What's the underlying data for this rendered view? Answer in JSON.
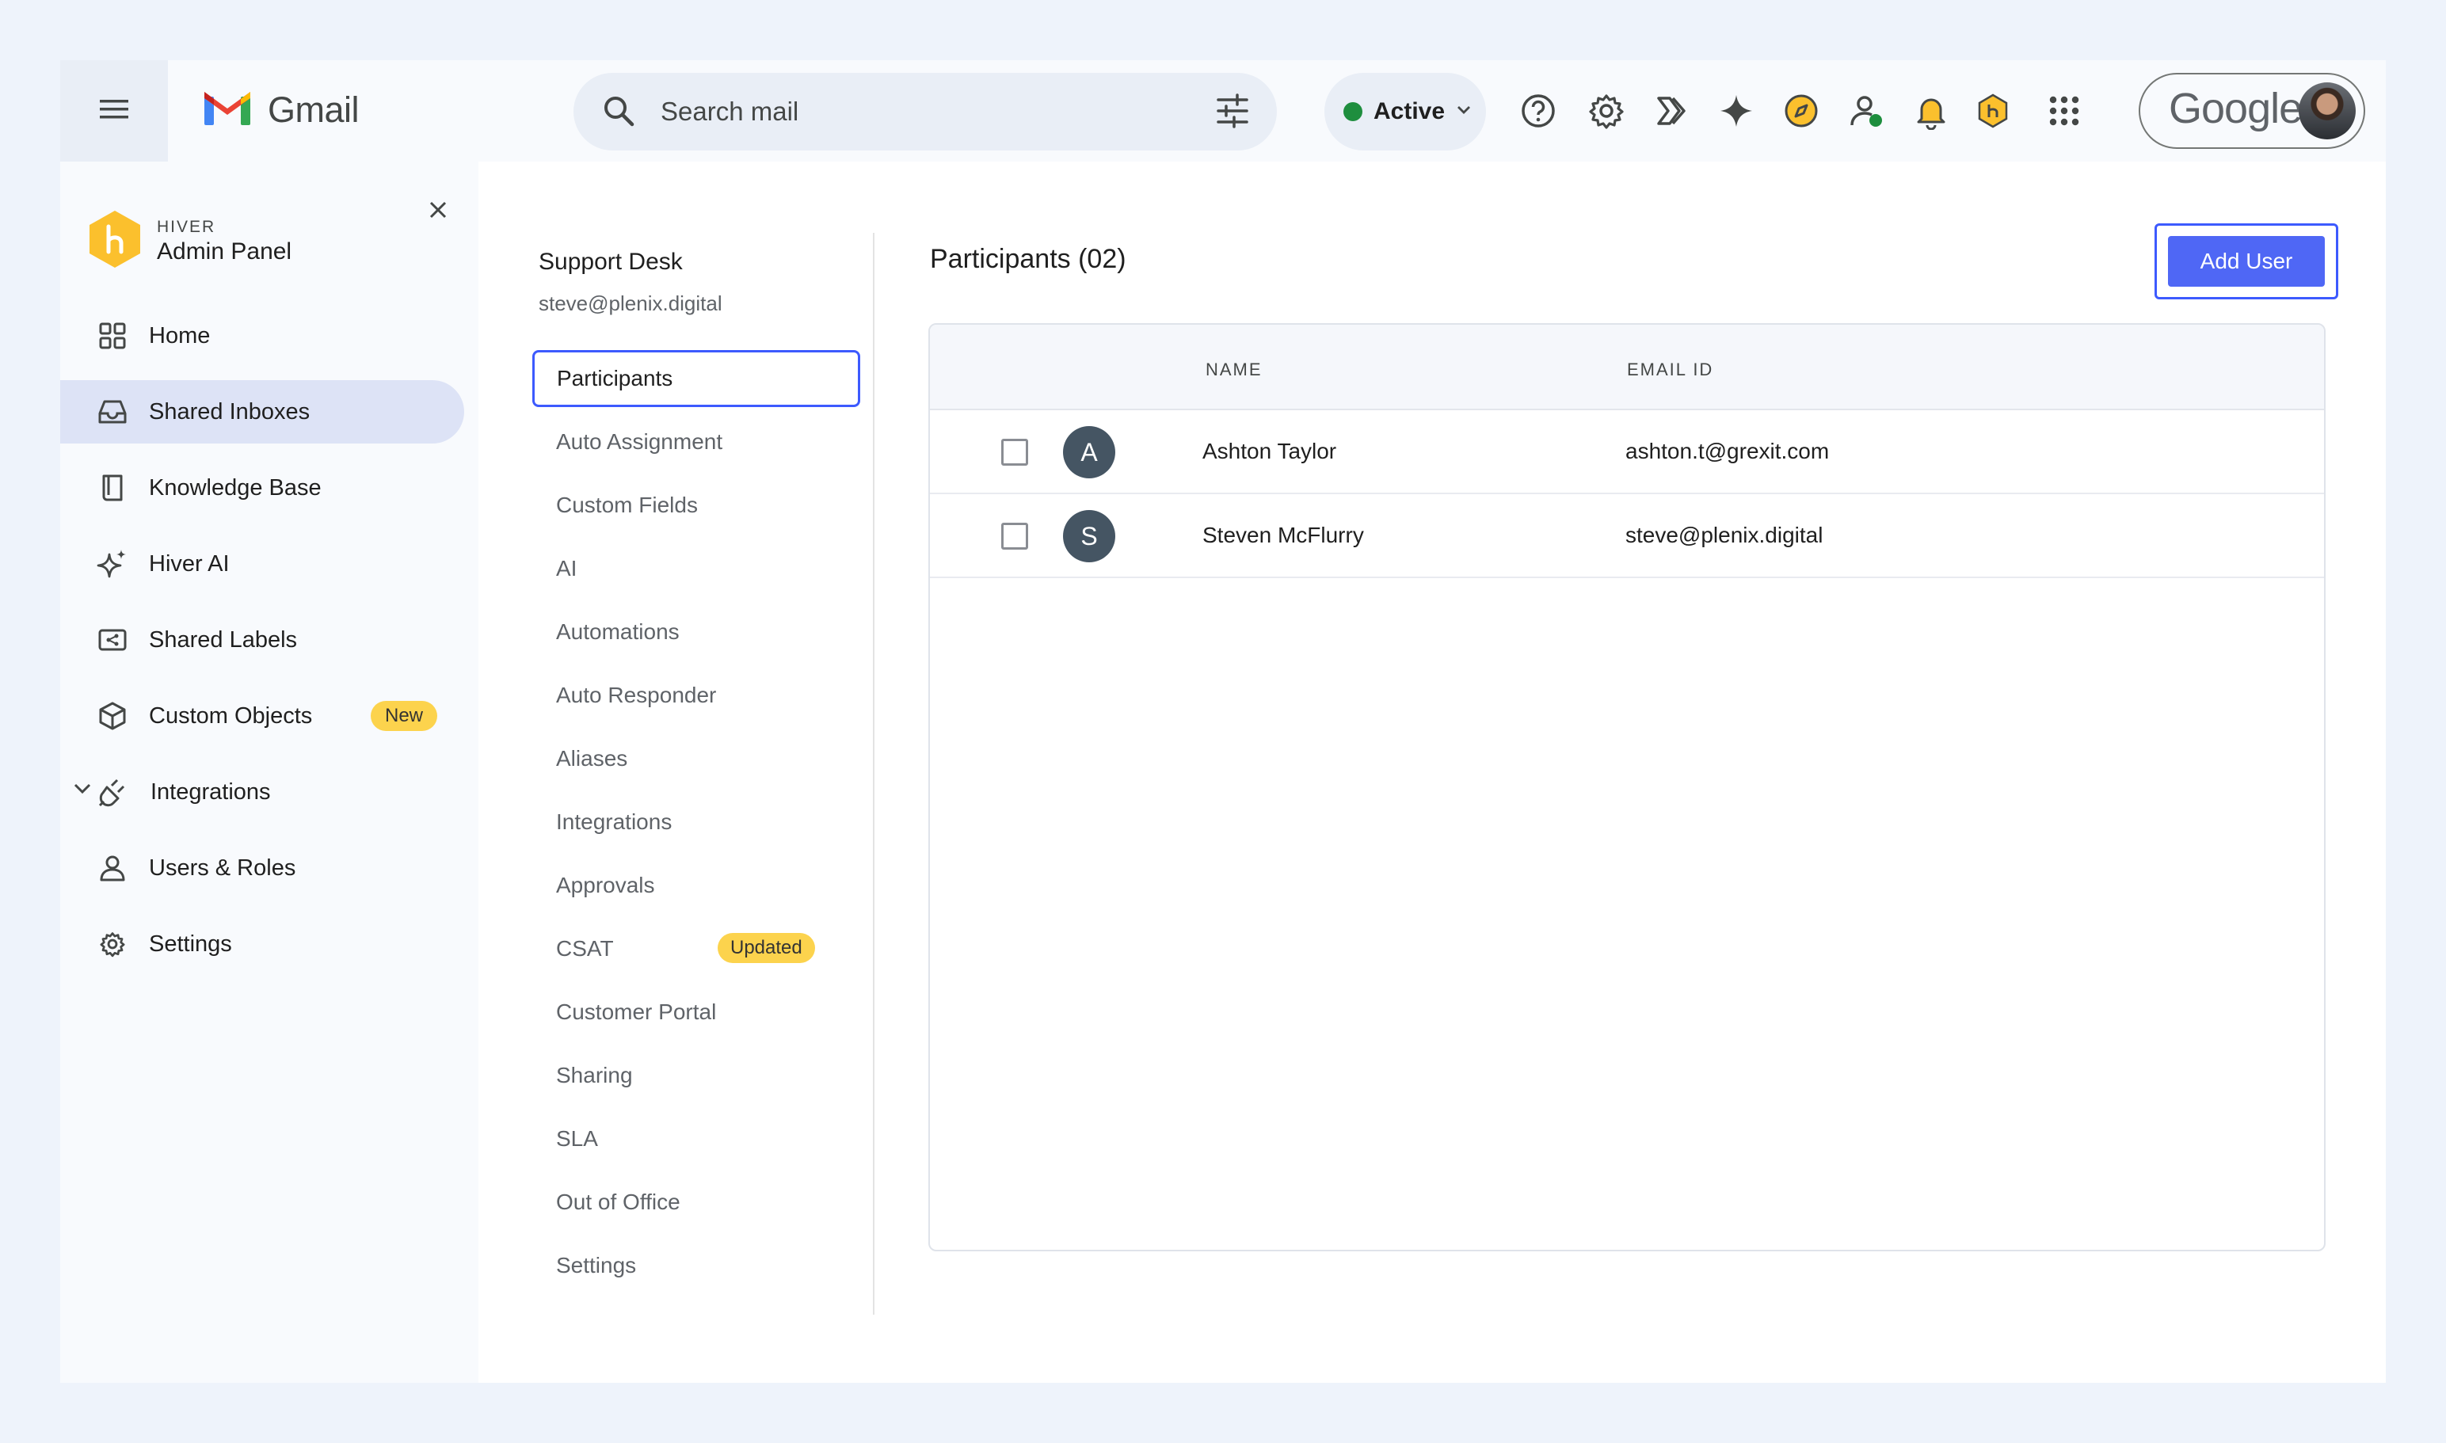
{
  "app": {
    "name": "Gmail"
  },
  "search": {
    "placeholder": "Search mail"
  },
  "status": {
    "label": "Active",
    "color": "#1e8e3e"
  },
  "account": {
    "brand": "Google"
  },
  "sidebar": {
    "brand_small": "HIVER",
    "brand_title": "Admin Panel",
    "items": [
      {
        "label": "Home",
        "icon": "grid-icon"
      },
      {
        "label": "Shared Inboxes",
        "icon": "inbox-icon",
        "active": true
      },
      {
        "label": "Knowledge Base",
        "icon": "book-icon"
      },
      {
        "label": "Hiver AI",
        "icon": "sparkle-icon"
      },
      {
        "label": "Shared Labels",
        "icon": "label-share-icon"
      },
      {
        "label": "Custom Objects",
        "icon": "cube-icon",
        "badge": "New"
      },
      {
        "label": "Integrations",
        "icon": "plug-icon"
      },
      {
        "label": "Users & Roles",
        "icon": "user-icon"
      },
      {
        "label": "Settings",
        "icon": "gear-icon"
      }
    ]
  },
  "inbox": {
    "name": "Support Desk",
    "email": "steve@plenix.digital",
    "menu": [
      {
        "label": "Participants",
        "active": true
      },
      {
        "label": "Auto Assignment"
      },
      {
        "label": "Custom Fields"
      },
      {
        "label": "AI"
      },
      {
        "label": "Automations"
      },
      {
        "label": "Auto Responder"
      },
      {
        "label": "Aliases"
      },
      {
        "label": "Integrations"
      },
      {
        "label": "Approvals"
      },
      {
        "label": "CSAT",
        "badge": "Updated"
      },
      {
        "label": "Customer Portal"
      },
      {
        "label": "Sharing"
      },
      {
        "label": "SLA"
      },
      {
        "label": "Out of Office"
      },
      {
        "label": "Settings"
      }
    ]
  },
  "participants": {
    "title": "Participants (02)",
    "add_button": "Add User",
    "columns": {
      "name": "NAME",
      "email": "EMAIL ID"
    },
    "rows": [
      {
        "initial": "A",
        "name": "Ashton Taylor",
        "email": "ashton.t@grexit.com"
      },
      {
        "initial": "S",
        "name": "Steven McFlurry",
        "email": "steve@plenix.digital"
      }
    ]
  },
  "colors": {
    "accent": "#3d5afe",
    "badge": "#fcd34d",
    "hiver_yellow": "#fbc02d"
  }
}
